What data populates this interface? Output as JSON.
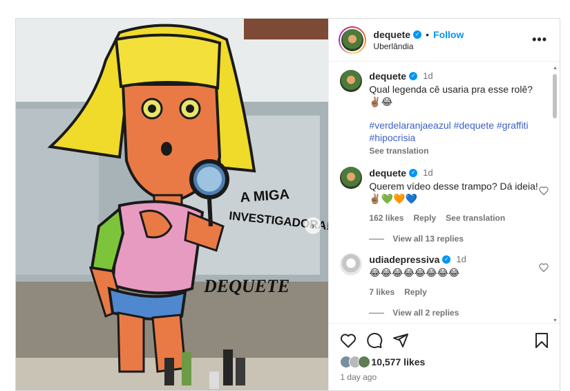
{
  "post": {
    "author": "dequete",
    "follow_label": "Follow",
    "location": "Uberlândia",
    "more_glyph": "•••",
    "separator": "•"
  },
  "media": {
    "graffiti_text_line1": "A MIGA",
    "graffiti_text_line2": "INVESTIGADORA!",
    "signature": "DEQUETE",
    "next_glyph": "›"
  },
  "comments": [
    {
      "user": "dequete",
      "time": "1d",
      "text": "Qual legenda cê usaria pra esse rolê? ✌🏽😂",
      "hashtags": "#verdelaranjaeazul #dequete #graffiti #hipocrisia",
      "see_translation": "See translation"
    },
    {
      "user": "dequete",
      "time": "1d",
      "text": "Querem vídeo desse trampo? Dá ideia! ✌🏽💚🧡💙",
      "likes": "162 likes",
      "reply": "Reply",
      "see_translation": "See translation",
      "view_replies": "View all 13 replies"
    },
    {
      "user": "udiadepressiva",
      "time": "1d",
      "text": "😂😂😂😂😂😂😂😂",
      "likes": "7 likes",
      "reply": "Reply",
      "view_replies": "View all 2 replies"
    }
  ],
  "footer": {
    "likes": "10,577 likes",
    "date": "1 day ago"
  },
  "colors": {
    "accent": "#0095f6",
    "hashtag": "#3b5fc8",
    "secondary_text": "#737373"
  }
}
